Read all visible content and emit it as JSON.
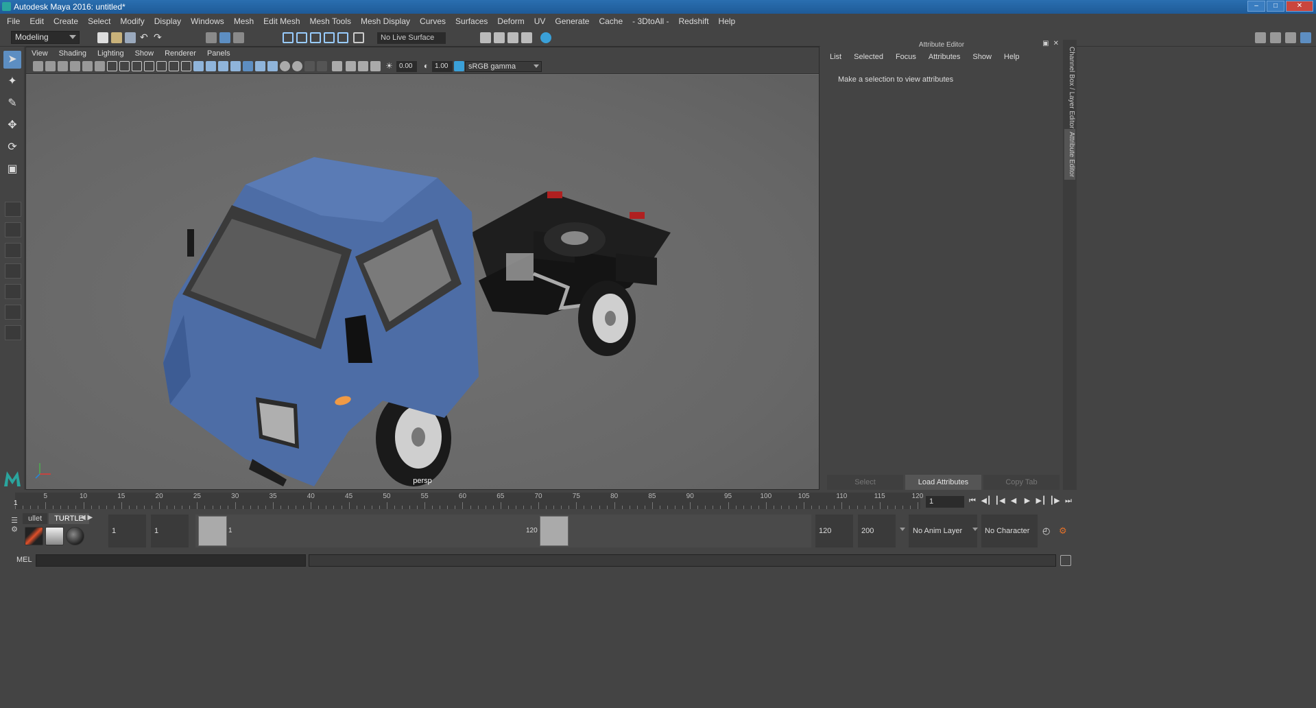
{
  "window": {
    "title": "Autodesk Maya 2016: untitled*"
  },
  "menubar": {
    "items": [
      "File",
      "Edit",
      "Create",
      "Select",
      "Modify",
      "Display",
      "Windows",
      "Mesh",
      "Edit Mesh",
      "Mesh Tools",
      "Mesh Display",
      "Curves",
      "Surfaces",
      "Deform",
      "UV",
      "Generate",
      "Cache",
      "- 3DtoAll -",
      "Redshift",
      "Help"
    ]
  },
  "status": {
    "mode": "Modeling",
    "live_surface": "No Live Surface"
  },
  "viewport": {
    "menu": [
      "View",
      "Shading",
      "Lighting",
      "Show",
      "Renderer",
      "Panels"
    ],
    "exposure": "0.00",
    "gamma": "1.00",
    "color_space": "sRGB gamma",
    "camera": "persp",
    "axis": {
      "y": "y",
      "x": "x"
    }
  },
  "attribute_editor": {
    "title": "Attribute Editor",
    "menu": [
      "List",
      "Selected",
      "Focus",
      "Attributes",
      "Show",
      "Help"
    ],
    "message": "Make a selection to view attributes",
    "buttons": {
      "select": "Select",
      "load": "Load Attributes",
      "copy": "Copy Tab"
    }
  },
  "side_tabs": {
    "channel_box": "Channel Box / Layer Editor",
    "attribute_editor": "Attribute Editor"
  },
  "timeslider": {
    "ticks": [
      "5",
      "10",
      "15",
      "20",
      "25",
      "30",
      "35",
      "40",
      "45",
      "50",
      "55",
      "60",
      "65",
      "70",
      "75",
      "80",
      "85",
      "90",
      "95",
      "100",
      "105",
      "110",
      "115",
      "120"
    ],
    "start_label": "1",
    "current_frame": "1"
  },
  "shelf": {
    "tabs": [
      "ullet",
      "TURTLE"
    ]
  },
  "range": {
    "start": "1",
    "playback_start": "1",
    "slider_start": "1",
    "slider_end": "120",
    "playback_end": "120",
    "end": "200",
    "anim_layer": "No Anim Layer",
    "character_set": "No Character Set"
  },
  "cmdline": {
    "label": "MEL"
  },
  "colors": {
    "accent": "#5d8ec2",
    "truck_body": "#4d6da6",
    "titlebar": "#1e5a97"
  }
}
